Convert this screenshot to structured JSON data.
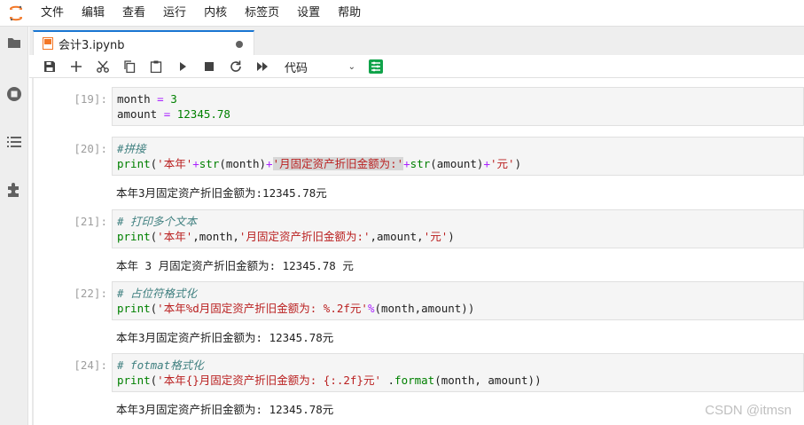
{
  "menu": [
    "文件",
    "编辑",
    "查看",
    "运行",
    "内核",
    "标签页",
    "设置",
    "帮助"
  ],
  "tab": {
    "title": "会计3.ipynb"
  },
  "toolbar": {
    "cell_type": "代码"
  },
  "cells": [
    {
      "prompt": "[19]:",
      "code_lines": [
        [
          {
            "t": "month ",
            "c": ""
          },
          {
            "t": "=",
            "c": "op"
          },
          {
            "t": " ",
            "c": ""
          },
          {
            "t": "3",
            "c": "num"
          }
        ],
        [
          {
            "t": "amount ",
            "c": ""
          },
          {
            "t": "=",
            "c": "op"
          },
          {
            "t": " ",
            "c": ""
          },
          {
            "t": "12345.78",
            "c": "num"
          }
        ]
      ],
      "output": ""
    },
    {
      "prompt": "[20]:",
      "code_lines": [
        [
          {
            "t": "#拼接",
            "c": "cmt"
          }
        ],
        [
          {
            "t": "print",
            "c": "kw"
          },
          {
            "t": "(",
            "c": ""
          },
          {
            "t": "'本年'",
            "c": "str"
          },
          {
            "t": "+",
            "c": "op"
          },
          {
            "t": "str",
            "c": "kw"
          },
          {
            "t": "(month)",
            "c": ""
          },
          {
            "t": "+",
            "c": "op"
          },
          {
            "t": "'月固定资产折旧金额为:'",
            "c": "str hl"
          },
          {
            "t": "+",
            "c": "op"
          },
          {
            "t": "str",
            "c": "kw"
          },
          {
            "t": "(amount)",
            "c": ""
          },
          {
            "t": "+",
            "c": "op"
          },
          {
            "t": "'元'",
            "c": "str"
          },
          {
            "t": ")",
            "c": ""
          }
        ]
      ],
      "output": "本年3月固定资产折旧金额为:12345.78元"
    },
    {
      "prompt": "[21]:",
      "code_lines": [
        [
          {
            "t": "# 打印多个文本",
            "c": "cmt"
          }
        ],
        [
          {
            "t": "print",
            "c": "kw"
          },
          {
            "t": "(",
            "c": ""
          },
          {
            "t": "'本年'",
            "c": "str"
          },
          {
            "t": ",month,",
            "c": ""
          },
          {
            "t": "'月固定资产折旧金额为:'",
            "c": "str"
          },
          {
            "t": ",amount,",
            "c": ""
          },
          {
            "t": "'元'",
            "c": "str"
          },
          {
            "t": ")",
            "c": ""
          }
        ]
      ],
      "output": "本年 3 月固定资产折旧金额为: 12345.78 元"
    },
    {
      "prompt": "[22]:",
      "code_lines": [
        [
          {
            "t": "# 占位符格式化",
            "c": "cmt"
          }
        ],
        [
          {
            "t": "print",
            "c": "kw"
          },
          {
            "t": "(",
            "c": ""
          },
          {
            "t": "'本年%d月固定资产折旧金额为: %.2f元'",
            "c": "str"
          },
          {
            "t": "%",
            "c": "op"
          },
          {
            "t": "(month,amount))",
            "c": ""
          }
        ]
      ],
      "output": "本年3月固定资产折旧金额为: 12345.78元"
    },
    {
      "prompt": "[24]:",
      "code_lines": [
        [
          {
            "t": "# fotmat格式化",
            "c": "cmt"
          }
        ],
        [
          {
            "t": "print",
            "c": "kw"
          },
          {
            "t": "(",
            "c": ""
          },
          {
            "t": "'本年{}月固定资产折旧金额为: {:.2f}元'",
            "c": "str"
          },
          {
            "t": " .",
            "c": ""
          },
          {
            "t": "format",
            "c": "kw"
          },
          {
            "t": "(month, amount))",
            "c": ""
          }
        ]
      ],
      "output": "本年3月固定资产折旧金额为: 12345.78元"
    }
  ],
  "watermark": "CSDN @itmsn",
  "colors": {
    "accent": "#1976d2",
    "keyword": "#008000",
    "string": "#ba2121",
    "operator": "#aa22ff",
    "comment": "#408080"
  }
}
